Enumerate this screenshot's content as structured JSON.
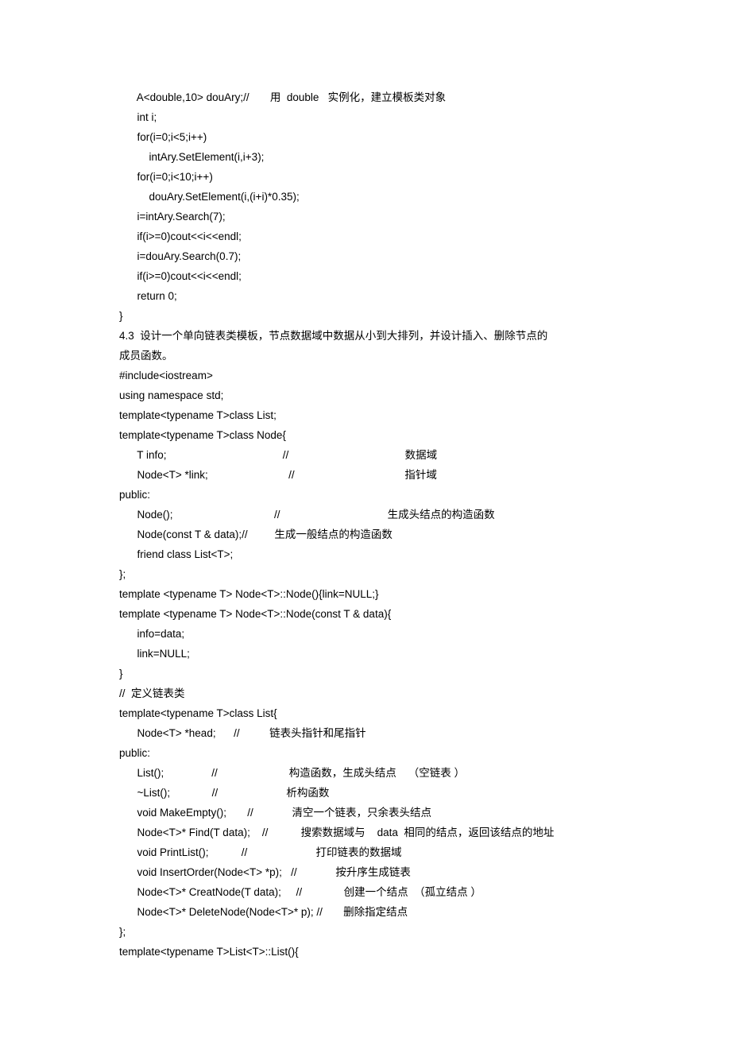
{
  "lines": [
    "      A<double,10> douAry;//       用  double   实例化，建立模板类对象",
    "      int i;",
    "      for(i=0;i<5;i++)",
    "          intAry.SetElement(i,i+3);",
    "      for(i=0;i<10;i++)",
    "          douAry.SetElement(i,(i+i)*0.35);",
    "      i=intAry.Search(7);",
    "      if(i>=0)cout<<i<<endl;",
    "      i=douAry.Search(0.7);",
    "      if(i>=0)cout<<i<<endl;",
    "      return 0;",
    "}",
    "4.3  设计一个单向链表类模板，节点数据域中数据从小到大排列，并设计插入、删除节点的",
    "成员函数。",
    "#include<iostream>",
    "using namespace std;",
    "template<typename T>class List;",
    "template<typename T>class Node{",
    "      T info;                                       //                                       数据域",
    "      Node<T> *link;                           //                                     指针域",
    "public:",
    "      Node();                                  //                                    生成头结点的构造函数",
    "      Node(const T & data);//         生成一般结点的构造函数",
    "      friend class List<T>;",
    "};",
    "template <typename T> Node<T>::Node(){link=NULL;}",
    "template <typename T> Node<T>::Node(const T & data){",
    "      info=data;",
    "      link=NULL;",
    "}",
    "//  定义链表类",
    "template<typename T>class List{",
    "      Node<T> *head;      //          链表头指针和尾指针",
    "public:",
    "      List();                //                        构造函数，生成头结点    （空链表 ）",
    "      ~List();              //                       析构函数",
    "      void MakeEmpty();       //             清空一个链表，只余表头结点",
    "      Node<T>* Find(T data);    //           搜索数据域与    data  相同的结点，返回该结点的地址",
    "      void PrintList();           //                       打印链表的数据域",
    "      void InsertOrder(Node<T> *p);   //             按升序生成链表",
    "      Node<T>* CreatNode(T data);     //              创建一个结点  （孤立结点 ）",
    "      Node<T>* DeleteNode(Node<T>* p); //       删除指定结点",
    "};",
    "template<typename T>List<T>::List(){"
  ]
}
